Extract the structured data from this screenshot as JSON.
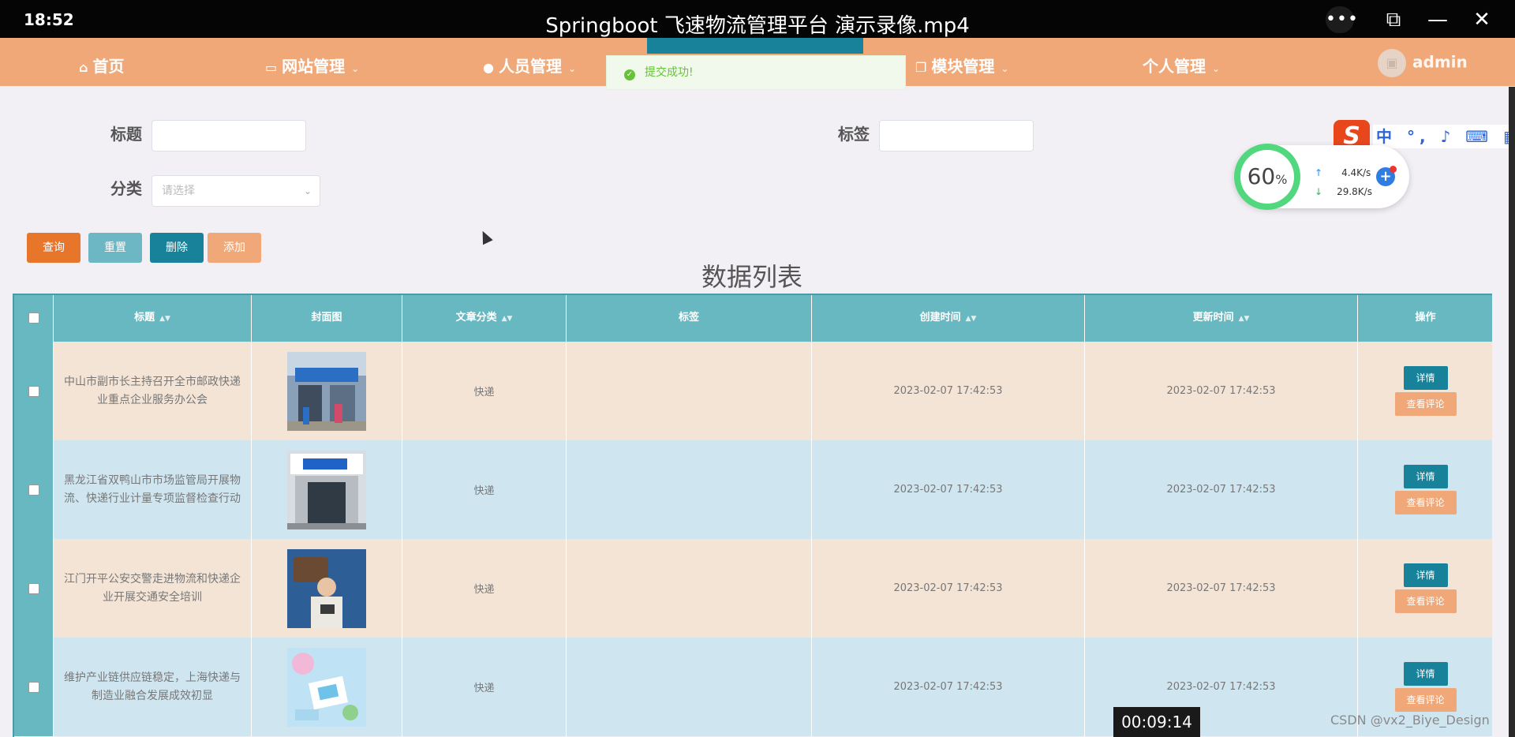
{
  "player": {
    "time": "18:52",
    "title": "Springboot 飞速物流管理平台 演示录像.mp4",
    "timestamp": "00:09:14",
    "watermark": "CSDN @vx2_Biye_Design",
    "more_icon": "•••",
    "pip_icon": "⧉",
    "min_icon": "—",
    "close_icon": "✕"
  },
  "nav": {
    "items": [
      {
        "label": "首页",
        "icon": "home-icon",
        "glyph": "⌂"
      },
      {
        "label": "网站管理",
        "icon": "monitor-icon",
        "glyph": "▭"
      },
      {
        "label": "人员管理",
        "icon": "user-icon",
        "glyph": "●"
      },
      {
        "label": "模块管理",
        "icon": "copy-icon",
        "glyph": "❐"
      },
      {
        "label": "个人管理",
        "icon": "none",
        "glyph": ""
      }
    ],
    "caret": "⌄",
    "user": "admin",
    "avatar_icon": "▣"
  },
  "toast": {
    "message": "提交成功!",
    "icon": "✓",
    "color": "#67c23a"
  },
  "search": {
    "title_label": "标题",
    "tag_label": "标签",
    "category_label": "分类",
    "category_placeholder": "请选择",
    "caret": "⌄"
  },
  "buttons": {
    "query": "查询",
    "reset": "重置",
    "delete": "删除",
    "add": "添加"
  },
  "list_title": "数据列表",
  "table": {
    "headers": [
      "标题",
      "封面图",
      "文章分类",
      "标签",
      "创建时间",
      "更新时间",
      "操作"
    ],
    "sort_icon": "▲▼",
    "rows": [
      {
        "title": "中山市副市长主持召开全市邮政快递业重点企业服务办公会",
        "category": "快递",
        "tag": "",
        "created": "2023-02-07 17:42:53",
        "updated": "2023-02-07 17:42:53"
      },
      {
        "title": "黑龙江省双鸭山市市场监管局开展物流、快递行业计量专项监督检查行动",
        "category": "快递",
        "tag": "",
        "created": "2023-02-07 17:42:53",
        "updated": "2023-02-07 17:42:53"
      },
      {
        "title": "江门开平公安交警走进物流和快递企业开展交通安全培训",
        "category": "快递",
        "tag": "",
        "created": "2023-02-07 17:42:53",
        "updated": "2023-02-07 17:42:53"
      },
      {
        "title": "维护产业链供应链稳定，上海快递与制造业融合发展成效初显",
        "category": "快递",
        "tag": "",
        "created": "2023-02-07 17:42:53",
        "updated": "2023-02-07 17:42:53"
      }
    ],
    "detail_label": "详情",
    "comment_label": "查看评论"
  },
  "ime": {
    "logo": "S",
    "bar": "中 °, ♪ ⌨ ▦"
  },
  "speed": {
    "percent": "60",
    "percent_unit": "%",
    "up": "4.4K/s",
    "down": "29.8K/s",
    "up_icon": "↑",
    "down_icon": "↓",
    "plus": "+"
  },
  "colors": {
    "nav_bg": "#f0a878",
    "nav_active": "#17829a",
    "header_bg": "#68b8c1",
    "row_odd": "#f3e4d6",
    "row_even": "#cfe6f1",
    "btn_query": "#e8762a",
    "btn_reset": "#6cb7c3",
    "btn_delete": "#17829a",
    "btn_add": "#f0a878"
  }
}
